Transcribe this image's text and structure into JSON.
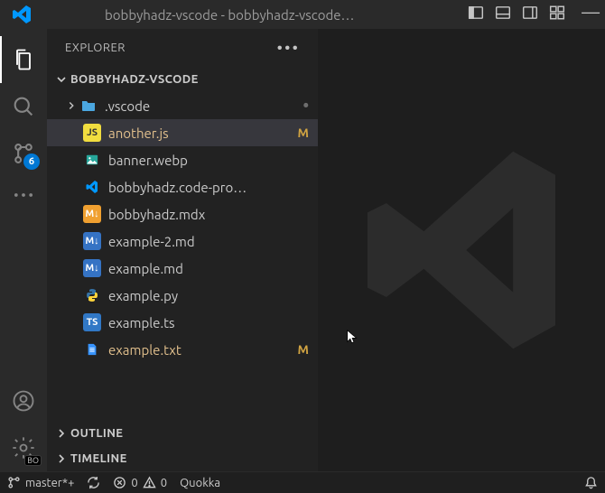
{
  "title": "bobbyhadz-vscode - bobbyhadz-vscode…",
  "explorer": {
    "label": "EXPLORER"
  },
  "project": {
    "name": "BOBBYHADZ-VSCODE"
  },
  "scm_badge": "6",
  "tree": [
    {
      "name": ".vscode",
      "kind": "folder",
      "decor": "•"
    },
    {
      "name": "another.js",
      "kind": "js",
      "decor": "M",
      "selected": true,
      "git": "m"
    },
    {
      "name": "banner.webp",
      "kind": "img"
    },
    {
      "name": "bobbyhadz.code-pro…",
      "kind": "vscode"
    },
    {
      "name": "bobbyhadz.mdx",
      "kind": "mdx"
    },
    {
      "name": "example-2.md",
      "kind": "md"
    },
    {
      "name": "example.md",
      "kind": "md"
    },
    {
      "name": "example.py",
      "kind": "py"
    },
    {
      "name": "example.ts",
      "kind": "ts"
    },
    {
      "name": "example.txt",
      "kind": "txt",
      "decor": "M",
      "git": "m"
    }
  ],
  "outline": {
    "label": "OUTLINE"
  },
  "timeline": {
    "label": "TIMELINE"
  },
  "statusbar": {
    "branch": "master*+",
    "errors": "0",
    "warnings": "0",
    "quokka": "Quokka"
  },
  "gear_badge": "BO"
}
